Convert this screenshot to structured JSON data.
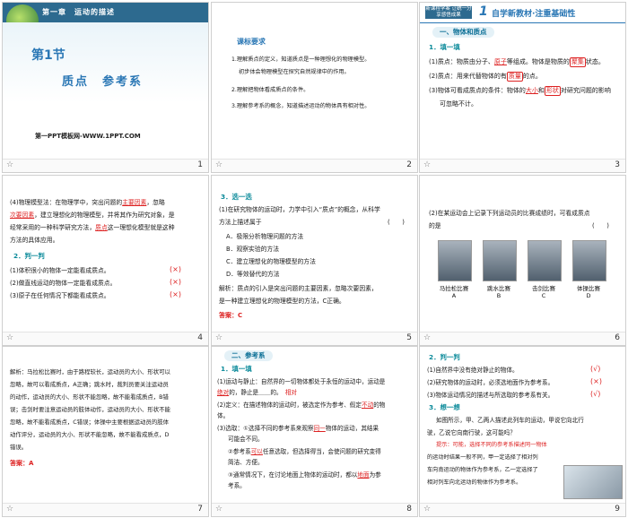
{
  "s1": {
    "chapter": "第一章　运动的描述",
    "section": "第1节",
    "title": "质点　参考系",
    "source": "第一PPT模板网-WWW.1PPT.COM",
    "num": "1"
  },
  "s2": {
    "heading": "课标要求",
    "items": [
      "1.理解质点的定义，知道质点是一种理想化的物理模型。",
      "初步体会物理模型在探究自然规律中的作用。",
      "2.理解把物体看成质点的条件。",
      "3.理解参考系的概念，知道描述运动的物体具有相对性。"
    ],
    "num": "2"
  },
  "s3": {
    "tag": "新课程学案 让统一分享感悟成果",
    "big": "1",
    "header": "自学新教材·注重基础性",
    "sec": "一、物体和质点",
    "sub": "1．填一填",
    "l1": "(1)质点：物质由分子、",
    "l1a": "原子",
    "l1b": "等组成。物体是物质的",
    "l1c": "聚集",
    "l1d": "状态。",
    "l2": "(2)质点：用来代替物体的有",
    "l2a": "质量",
    "l2b": "的点。",
    "l3": "(3)物体可看成质点的条件：物体的",
    "l3a": "大小",
    "l3b": "和",
    "l3c": "形状",
    "l3d": "对研究问题的影响",
    "l3e": "可忽略不计。",
    "num": "3"
  },
  "s4": {
    "p1a": "(4)物理模型法：在物理学中，突出问题的",
    "p1b": "主要因素",
    "p1c": "，忽略",
    "p2a": "次要因素",
    "p2b": "，建立理想化的物理模型，并将其作为研究对象，是",
    "p3": "经常采用的一种科学研究方法，",
    "p3b": "质点",
    "p3c": "这一理想化模型就是这种",
    "p4": "方法的具体应用。",
    "sub": "2．判一判",
    "j": [
      {
        "t": "(1)体积很小的物体一定能看成质点。",
        "a": "(×)"
      },
      {
        "t": "(2)做直线运动的物体一定能看成质点。",
        "a": "(×)"
      },
      {
        "t": "(3)原子在任何情况下都能看成质点。",
        "a": "(×)"
      }
    ],
    "num": "4"
  },
  "s5": {
    "sub": "3．选一选",
    "q1": "(1)在研究物体的运动时，力学中引入“质点”的概念，从科学",
    "q2": "方法上描述属于",
    "blank": "(　　)",
    "opts": [
      "A．极限分析物理问题的方法",
      "B．观察实验的方法",
      "C．建立理想化的物理模型的方法",
      "D．等效替代的方法"
    ],
    "e1": "解析：质点的引入是突出问题的主要因素，忽略次要因素，",
    "e2": "是一种建立理想化的物理模型的方法，C正确。",
    "answer": "答案：C",
    "num": "5"
  },
  "s6": {
    "q1": "(2)在某运动会上记录下列运动员的比赛成绩时，可看成质点",
    "q2": "的是",
    "blank": "(　　)",
    "caps": [
      "马拉松比赛\nA",
      "跳水比赛\nB",
      "击剑比赛\nC",
      "体操比赛\nD"
    ],
    "num": "6"
  },
  "s7": {
    "lines": [
      "解析：马拉松比赛时，由于路程较长，运动员的大小、形状可以",
      "忽略，故可以看成质点，A正确；跳水时，裁判员要关注运动员",
      "的动作，运动员的大小、形状不能忽略，故不能看成质点，B错",
      "误；击剑时要注意运动员的肢体动作，运动员的大小、形状不能",
      "忽略，故不能看成质点，C错误；体操中主要根据运动员的肢体",
      "动作评分，运动员的大小、形状不能忽略，故不能看成质点，D",
      "错误。"
    ],
    "answer": "答案：A",
    "num": "7"
  },
  "s8": {
    "sec": "二、参考系",
    "sub": "1．填一填",
    "l1": "(1)运动与静止：自然界的一切物体都处于永恒的运动中，运动是",
    "l2a": "的，静止是",
    "l2b": "的。",
    "l2c": "绝对",
    "l2d": "相对",
    "l3": "(2)定义：在描述物体的运动时，被选定作为参考、假定",
    "l3a": "不动",
    "l3b": "的物",
    "l4": "体。",
    "l5": "(3)选取：①选择不同的参考系来观察",
    "l5a": "同一",
    "l5b": "物体的运动，其结果",
    "l6": "可能会不同。",
    "l7": "②参考系",
    "l7a": "可以",
    "l7b": "任意选取，但选择得当，会使问题的研究变得",
    "l8": "简洁、方便。",
    "l9": "③通常情况下，在讨论地面上物体的运动时，都以",
    "l9a": "地面",
    "l9b": "为参",
    "l10": "考系。",
    "num": "8"
  },
  "s9": {
    "sub": "2．判一判",
    "j": [
      {
        "t": "(1)自然界中没有绝对静止的物体。",
        "a": "(√)"
      },
      {
        "t": "(2)研究物体的运动时，必须选地面作为参考系。",
        "a": "(×)"
      },
      {
        "t": "(3)物体运动情况的描述与所选取的参考系有关。",
        "a": "(√)"
      }
    ],
    "sub2": "3．想一想",
    "q1": "如图所示，甲、乙两人描述此列车的运动，甲说它向北行",
    "q2": "驶，乙说它向南行驶，这可能吗？",
    "tip": [
      "提示：可能，选择不同的参考系描述同一物体",
      "的运动时结果一般不同，甲一定选择了相对列",
      "车向南运动的物体作为参考系，乙一定选择了",
      "相对列车向北运动的物体作为参考系。"
    ],
    "num": "9"
  },
  "colors": {
    "accent": "#2a77b5",
    "answer": "#dd2222",
    "teal": "#0b8a9a"
  }
}
